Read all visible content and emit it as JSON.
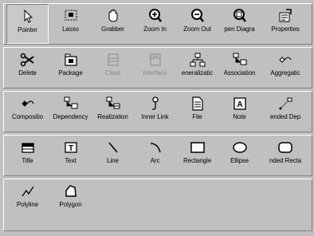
{
  "rows": [
    [
      {
        "label": "Pointer",
        "icon": "pointer-icon",
        "selected": true
      },
      {
        "label": "Lasso",
        "icon": "lasso-icon"
      },
      {
        "label": "Grabber",
        "icon": "grabber-hand-icon"
      },
      {
        "label": "Zoom In",
        "icon": "zoom-in-icon"
      },
      {
        "label": "Zoom Out",
        "icon": "zoom-out-icon"
      },
      {
        "label": "pen Diagra",
        "icon": "open-diagram-icon"
      },
      {
        "label": "Properties",
        "icon": "properties-icon"
      }
    ],
    [
      {
        "label": "Delete",
        "icon": "delete-scissors-icon"
      },
      {
        "label": "Package",
        "icon": "package-icon"
      },
      {
        "label": "Class",
        "icon": "class-icon",
        "disabled": true
      },
      {
        "label": "Interface",
        "icon": "interface-icon",
        "disabled": true
      },
      {
        "label": "eneralizatic",
        "icon": "generalization-icon"
      },
      {
        "label": "Association",
        "icon": "association-icon"
      },
      {
        "label": "Aggregatic",
        "icon": "aggregation-icon"
      }
    ],
    [
      {
        "label": "Compositio",
        "icon": "composition-icon"
      },
      {
        "label": "Dependency",
        "icon": "dependency-icon"
      },
      {
        "label": "Realization",
        "icon": "realization-icon"
      },
      {
        "label": "Inner Link",
        "icon": "inner-link-icon"
      },
      {
        "label": "File",
        "icon": "file-icon"
      },
      {
        "label": "Note",
        "icon": "note-icon"
      },
      {
        "label": "ended Dep",
        "icon": "extended-dependency-icon"
      }
    ],
    [
      {
        "label": "Title",
        "icon": "title-icon"
      },
      {
        "label": "Text",
        "icon": "text-icon"
      },
      {
        "label": "Line",
        "icon": "line-icon"
      },
      {
        "label": "Arc",
        "icon": "arc-icon"
      },
      {
        "label": "Rectangle",
        "icon": "rectangle-icon"
      },
      {
        "label": "Ellipse",
        "icon": "ellipse-icon"
      },
      {
        "label": "nded Recta",
        "icon": "rounded-rectangle-icon"
      }
    ],
    [
      {
        "label": "Polyline",
        "icon": "polyline-icon"
      },
      {
        "label": "Polygon",
        "icon": "polygon-icon"
      }
    ]
  ],
  "colors": {
    "background": "#c0c0c0",
    "disabled_text": "#8a8a8a"
  }
}
